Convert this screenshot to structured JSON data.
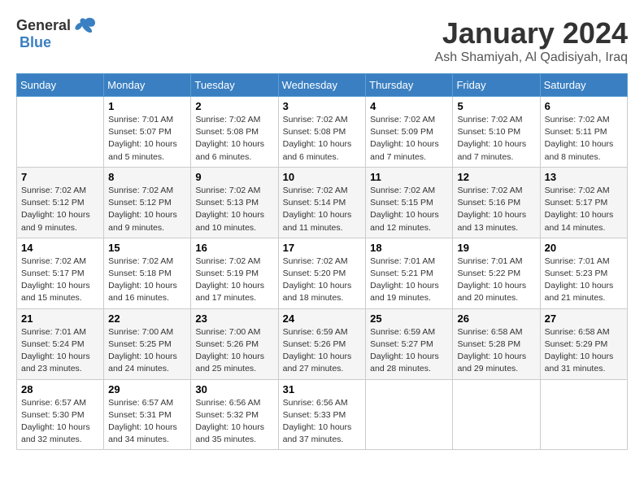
{
  "logo": {
    "general": "General",
    "blue": "Blue"
  },
  "title": "January 2024",
  "location": "Ash Shamiyah, Al Qadisiyah, Iraq",
  "days_of_week": [
    "Sunday",
    "Monday",
    "Tuesday",
    "Wednesday",
    "Thursday",
    "Friday",
    "Saturday"
  ],
  "weeks": [
    [
      {
        "day": "",
        "sunrise": "",
        "sunset": "",
        "daylight": ""
      },
      {
        "day": "1",
        "sunrise": "Sunrise: 7:01 AM",
        "sunset": "Sunset: 5:07 PM",
        "daylight": "Daylight: 10 hours and 5 minutes."
      },
      {
        "day": "2",
        "sunrise": "Sunrise: 7:02 AM",
        "sunset": "Sunset: 5:08 PM",
        "daylight": "Daylight: 10 hours and 6 minutes."
      },
      {
        "day": "3",
        "sunrise": "Sunrise: 7:02 AM",
        "sunset": "Sunset: 5:08 PM",
        "daylight": "Daylight: 10 hours and 6 minutes."
      },
      {
        "day": "4",
        "sunrise": "Sunrise: 7:02 AM",
        "sunset": "Sunset: 5:09 PM",
        "daylight": "Daylight: 10 hours and 7 minutes."
      },
      {
        "day": "5",
        "sunrise": "Sunrise: 7:02 AM",
        "sunset": "Sunset: 5:10 PM",
        "daylight": "Daylight: 10 hours and 7 minutes."
      },
      {
        "day": "6",
        "sunrise": "Sunrise: 7:02 AM",
        "sunset": "Sunset: 5:11 PM",
        "daylight": "Daylight: 10 hours and 8 minutes."
      }
    ],
    [
      {
        "day": "7",
        "sunrise": "Sunrise: 7:02 AM",
        "sunset": "Sunset: 5:12 PM",
        "daylight": "Daylight: 10 hours and 9 minutes."
      },
      {
        "day": "8",
        "sunrise": "Sunrise: 7:02 AM",
        "sunset": "Sunset: 5:12 PM",
        "daylight": "Daylight: 10 hours and 9 minutes."
      },
      {
        "day": "9",
        "sunrise": "Sunrise: 7:02 AM",
        "sunset": "Sunset: 5:13 PM",
        "daylight": "Daylight: 10 hours and 10 minutes."
      },
      {
        "day": "10",
        "sunrise": "Sunrise: 7:02 AM",
        "sunset": "Sunset: 5:14 PM",
        "daylight": "Daylight: 10 hours and 11 minutes."
      },
      {
        "day": "11",
        "sunrise": "Sunrise: 7:02 AM",
        "sunset": "Sunset: 5:15 PM",
        "daylight": "Daylight: 10 hours and 12 minutes."
      },
      {
        "day": "12",
        "sunrise": "Sunrise: 7:02 AM",
        "sunset": "Sunset: 5:16 PM",
        "daylight": "Daylight: 10 hours and 13 minutes."
      },
      {
        "day": "13",
        "sunrise": "Sunrise: 7:02 AM",
        "sunset": "Sunset: 5:17 PM",
        "daylight": "Daylight: 10 hours and 14 minutes."
      }
    ],
    [
      {
        "day": "14",
        "sunrise": "Sunrise: 7:02 AM",
        "sunset": "Sunset: 5:17 PM",
        "daylight": "Daylight: 10 hours and 15 minutes."
      },
      {
        "day": "15",
        "sunrise": "Sunrise: 7:02 AM",
        "sunset": "Sunset: 5:18 PM",
        "daylight": "Daylight: 10 hours and 16 minutes."
      },
      {
        "day": "16",
        "sunrise": "Sunrise: 7:02 AM",
        "sunset": "Sunset: 5:19 PM",
        "daylight": "Daylight: 10 hours and 17 minutes."
      },
      {
        "day": "17",
        "sunrise": "Sunrise: 7:02 AM",
        "sunset": "Sunset: 5:20 PM",
        "daylight": "Daylight: 10 hours and 18 minutes."
      },
      {
        "day": "18",
        "sunrise": "Sunrise: 7:01 AM",
        "sunset": "Sunset: 5:21 PM",
        "daylight": "Daylight: 10 hours and 19 minutes."
      },
      {
        "day": "19",
        "sunrise": "Sunrise: 7:01 AM",
        "sunset": "Sunset: 5:22 PM",
        "daylight": "Daylight: 10 hours and 20 minutes."
      },
      {
        "day": "20",
        "sunrise": "Sunrise: 7:01 AM",
        "sunset": "Sunset: 5:23 PM",
        "daylight": "Daylight: 10 hours and 21 minutes."
      }
    ],
    [
      {
        "day": "21",
        "sunrise": "Sunrise: 7:01 AM",
        "sunset": "Sunset: 5:24 PM",
        "daylight": "Daylight: 10 hours and 23 minutes."
      },
      {
        "day": "22",
        "sunrise": "Sunrise: 7:00 AM",
        "sunset": "Sunset: 5:25 PM",
        "daylight": "Daylight: 10 hours and 24 minutes."
      },
      {
        "day": "23",
        "sunrise": "Sunrise: 7:00 AM",
        "sunset": "Sunset: 5:26 PM",
        "daylight": "Daylight: 10 hours and 25 minutes."
      },
      {
        "day": "24",
        "sunrise": "Sunrise: 6:59 AM",
        "sunset": "Sunset: 5:26 PM",
        "daylight": "Daylight: 10 hours and 27 minutes."
      },
      {
        "day": "25",
        "sunrise": "Sunrise: 6:59 AM",
        "sunset": "Sunset: 5:27 PM",
        "daylight": "Daylight: 10 hours and 28 minutes."
      },
      {
        "day": "26",
        "sunrise": "Sunrise: 6:58 AM",
        "sunset": "Sunset: 5:28 PM",
        "daylight": "Daylight: 10 hours and 29 minutes."
      },
      {
        "day": "27",
        "sunrise": "Sunrise: 6:58 AM",
        "sunset": "Sunset: 5:29 PM",
        "daylight": "Daylight: 10 hours and 31 minutes."
      }
    ],
    [
      {
        "day": "28",
        "sunrise": "Sunrise: 6:57 AM",
        "sunset": "Sunset: 5:30 PM",
        "daylight": "Daylight: 10 hours and 32 minutes."
      },
      {
        "day": "29",
        "sunrise": "Sunrise: 6:57 AM",
        "sunset": "Sunset: 5:31 PM",
        "daylight": "Daylight: 10 hours and 34 minutes."
      },
      {
        "day": "30",
        "sunrise": "Sunrise: 6:56 AM",
        "sunset": "Sunset: 5:32 PM",
        "daylight": "Daylight: 10 hours and 35 minutes."
      },
      {
        "day": "31",
        "sunrise": "Sunrise: 6:56 AM",
        "sunset": "Sunset: 5:33 PM",
        "daylight": "Daylight: 10 hours and 37 minutes."
      },
      {
        "day": "",
        "sunrise": "",
        "sunset": "",
        "daylight": ""
      },
      {
        "day": "",
        "sunrise": "",
        "sunset": "",
        "daylight": ""
      },
      {
        "day": "",
        "sunrise": "",
        "sunset": "",
        "daylight": ""
      }
    ]
  ]
}
